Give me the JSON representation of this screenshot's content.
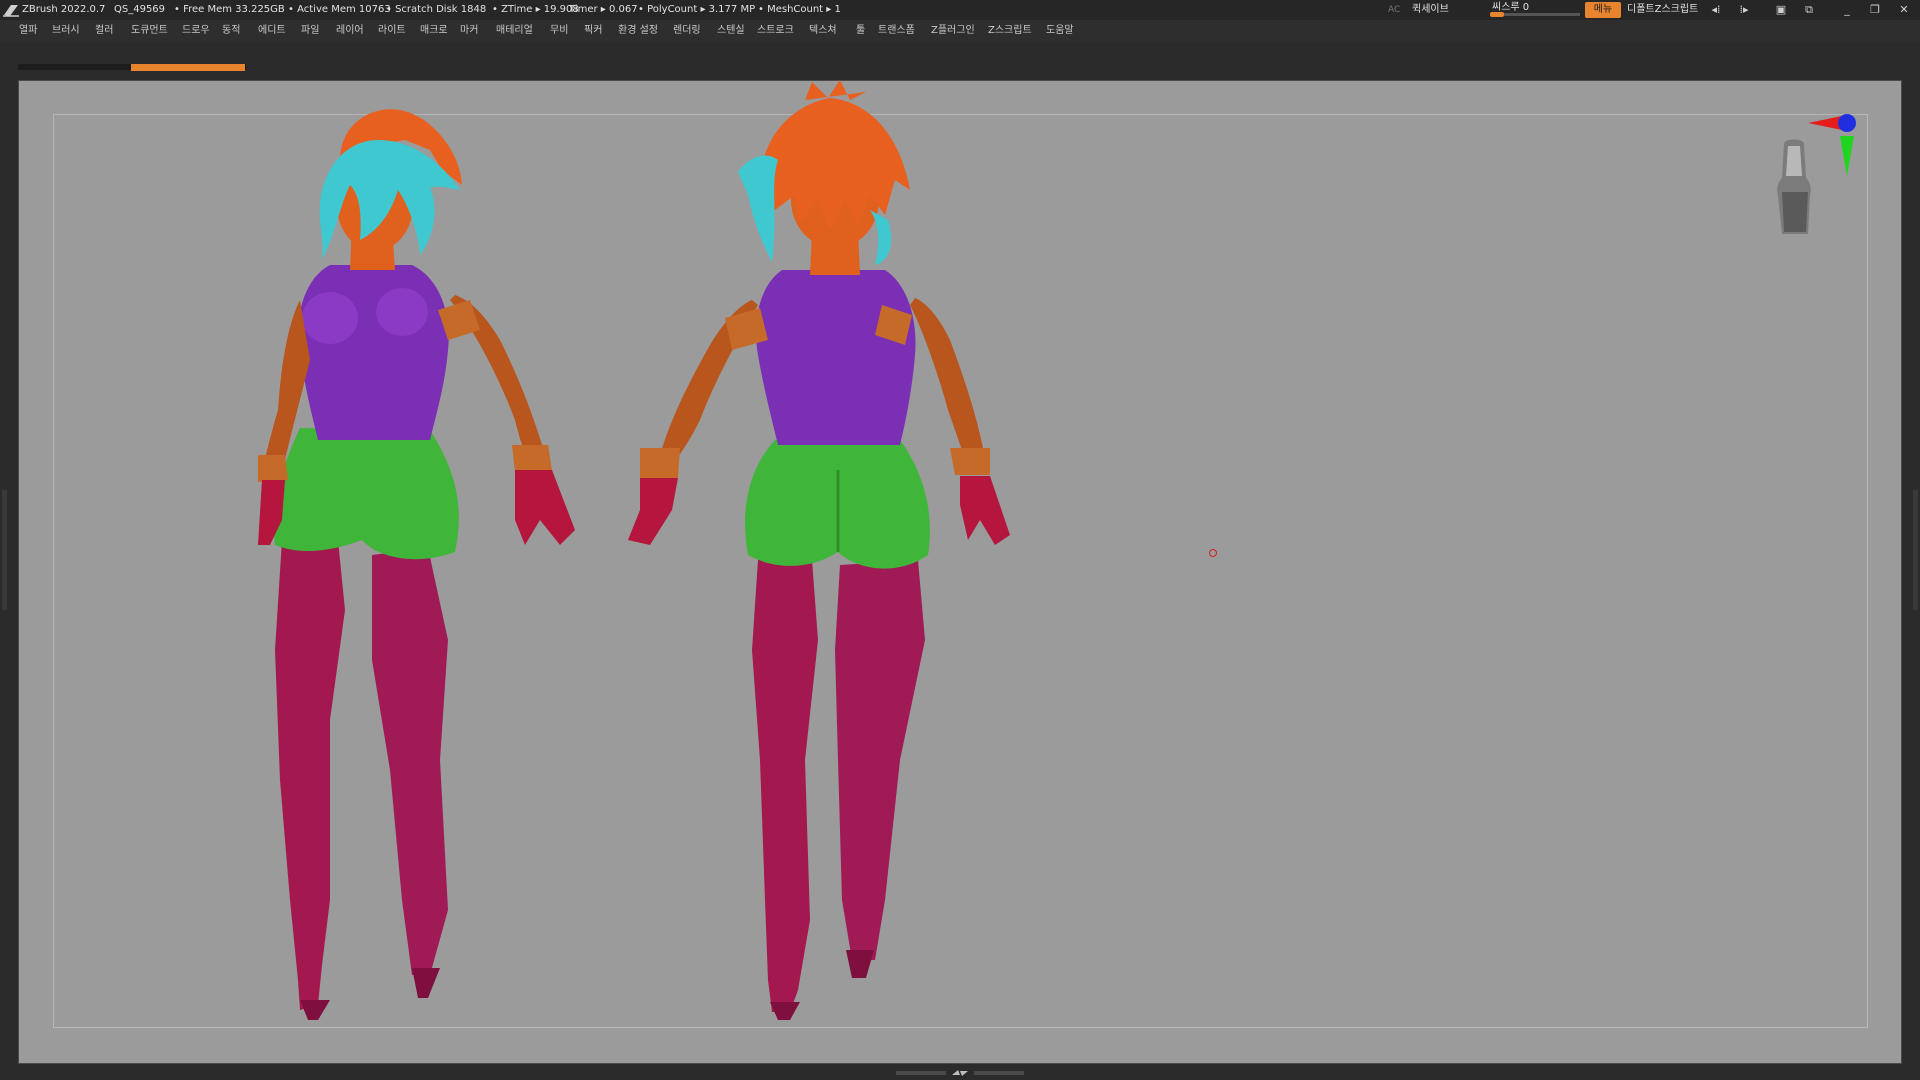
{
  "titlebar": {
    "app_version": "ZBrush 2022.0.7",
    "quicksave_id": "QS_49569",
    "free_mem": "• Free Mem 33.225GB",
    "active_mem": "• Active Mem 10763",
    "scratch_disk": "• Scratch Disk 1848",
    "ztime": "• ZTime ▸ 19.908",
    "timer": "Timer ▸ 0.067",
    "polycount": "• PolyCount ▸ 3.177 MP",
    "meshcount": "• MeshCount ▸ 1",
    "ac_label": "AC",
    "quicksave_label": "퀵세이브",
    "seethrough_label": "씨스루 0",
    "seethrough_value": 0,
    "menus_label": "메뉴",
    "default_zscript_label": "디폴트Z스크립트",
    "accent_color": "#e8842d"
  },
  "menubar": {
    "items": [
      "열파",
      "브러시",
      "컬러",
      "도큐먼트",
      "드로우",
      "동적",
      "에디트",
      "파일",
      "레이어",
      "라이트",
      "매크로",
      "마커",
      "매테리얼",
      "무비",
      "픽커",
      "환경 설정",
      "렌더링",
      "스텐실",
      "스트로크",
      "텍스쳐",
      "툴",
      "트랜스폼",
      "Z플러그인",
      "Z스크립트",
      "도움말"
    ]
  },
  "icons": {
    "logo": "zbrush-logo-icon",
    "window_controls": [
      "minimize-icon",
      "restore-icon",
      "close-icon"
    ]
  },
  "viewport": {
    "background_color": "#9b9b9b",
    "model_colors": {
      "skin": "#e0611e",
      "hair_orange": "#e8601f",
      "hair_cyan": "#3fc8d0",
      "top": "#7a2fb5",
      "shorts": "#3fb53a",
      "boots": "#a3184f",
      "gloves": "#b5163e",
      "arms": "#b8561d",
      "bands": "#c66a2a"
    }
  }
}
